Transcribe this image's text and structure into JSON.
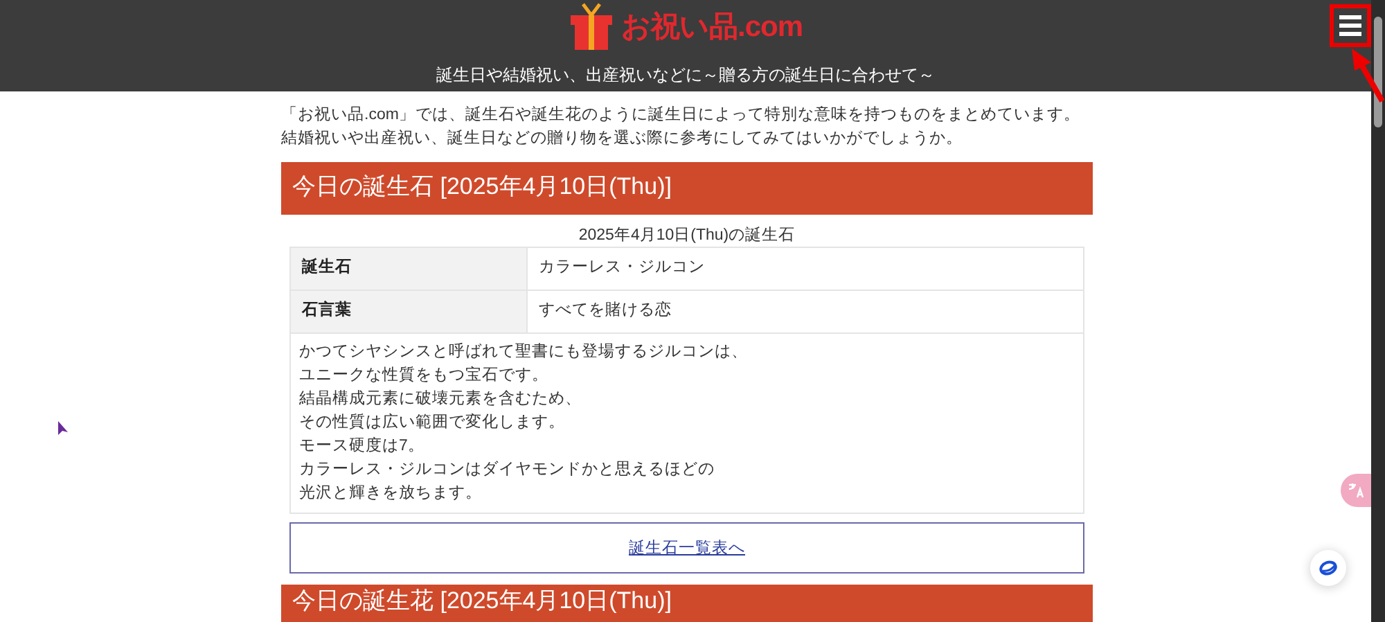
{
  "header": {
    "logo": "お祝い品.com",
    "tagline": "誕生日や結婚祝い、出産祝いなどに～贈る方の誕生日に合わせて～"
  },
  "annotation": {
    "kind": "box-and-arrow"
  },
  "intro": [
    "「お祝い品.com」では、誕生石や誕生花のように誕生日によって特別な意味を持つものをまとめています。",
    "結婚祝いや出産祝い、誕生日などの贈り物を選ぶ際に参考にしてみてはいかがでしょうか。"
  ],
  "sections": [
    {
      "heading": "今日の誕生石 [2025年4月10日(Thu)]",
      "caption": "2025年4月10日(Thu)の誕生石",
      "rows": [
        {
          "label": "誕生石",
          "value": "カラーレス・ジルコン"
        },
        {
          "label": "石言葉",
          "value": "すべてを賭ける恋"
        }
      ],
      "description": [
        "かつてシヤシンスと呼ばれて聖書にも登場するジルコンは、",
        "ユニークな性質をもつ宝石です。",
        "結晶構成元素に破壊元素を含むため、",
        "その性質は広い範囲で変化します。",
        "モース硬度は7。",
        "カラーレス・ジルコンはダイヤモンドかと思えるほどの",
        "光沢と輝きを放ちます。"
      ],
      "link": "誕生石一覧表へ"
    },
    {
      "heading": "今日の誕生花 [2025年4月10日(Thu)]"
    }
  ]
}
